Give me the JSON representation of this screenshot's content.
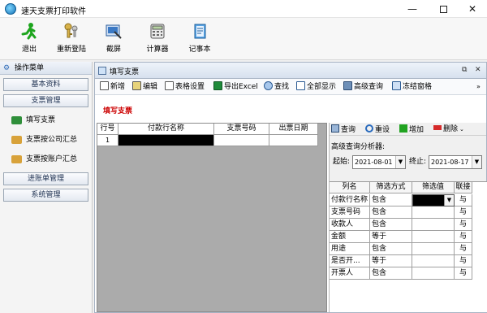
{
  "window": {
    "title": "速天支票打印软件"
  },
  "toolbar": {
    "items": [
      {
        "label": "退出",
        "icon": "running-man-icon"
      },
      {
        "label": "重新登陆",
        "icon": "keys-icon"
      },
      {
        "label": "截屏",
        "icon": "screenshot-icon"
      },
      {
        "label": "计算器",
        "icon": "calculator-icon"
      },
      {
        "label": "记事本",
        "icon": "notepad-icon"
      }
    ]
  },
  "sidebar": {
    "header": "操作菜单",
    "groups": [
      "基本资料",
      "支票管理",
      "进账单管理",
      "系统管理"
    ],
    "items": [
      "填写支票",
      "支票按公司汇总",
      "支票按账户汇总"
    ]
  },
  "child": {
    "title": "填写支票",
    "form_title": "填写支票",
    "toolbar": [
      "新增",
      "编辑",
      "表格设置",
      "导出Excel",
      "查找",
      "全部显示",
      "高级查询",
      "冻结窗格"
    ]
  },
  "grid": {
    "columns": [
      "行号",
      "付款行名称",
      "支票号码",
      "出票日期"
    ],
    "rows": [
      {
        "row_no": "1",
        "bank_name": "",
        "check_no": "",
        "date": ""
      }
    ]
  },
  "query": {
    "toolbar": [
      "查询",
      "重设",
      "增加",
      "删除"
    ],
    "analyzer_label": "高级查询分析器:",
    "start_label": "起始:",
    "start_value": "2021-08-01",
    "end_label": "终止:",
    "end_value": "2021-08-17",
    "columns": [
      "列名",
      "筛选方式",
      "筛选值",
      "联接"
    ],
    "rows": [
      {
        "name": "付款行名称",
        "mode": "包含",
        "value": "",
        "join": "与"
      },
      {
        "name": "支票号码",
        "mode": "包含",
        "value": "",
        "join": "与"
      },
      {
        "name": "收款人",
        "mode": "包含",
        "value": "",
        "join": "与"
      },
      {
        "name": "金额",
        "mode": "等于",
        "value": "",
        "join": "与"
      },
      {
        "name": "用途",
        "mode": "包含",
        "value": "",
        "join": "与"
      },
      {
        "name": "是否开...",
        "mode": "等于",
        "value": "",
        "join": "与"
      },
      {
        "name": "开票人",
        "mode": "包含",
        "value": "",
        "join": "与"
      }
    ]
  },
  "colors": {
    "form_title": "#cc0000",
    "selected_cell": "#000000",
    "grid_bg": "#ababab"
  }
}
